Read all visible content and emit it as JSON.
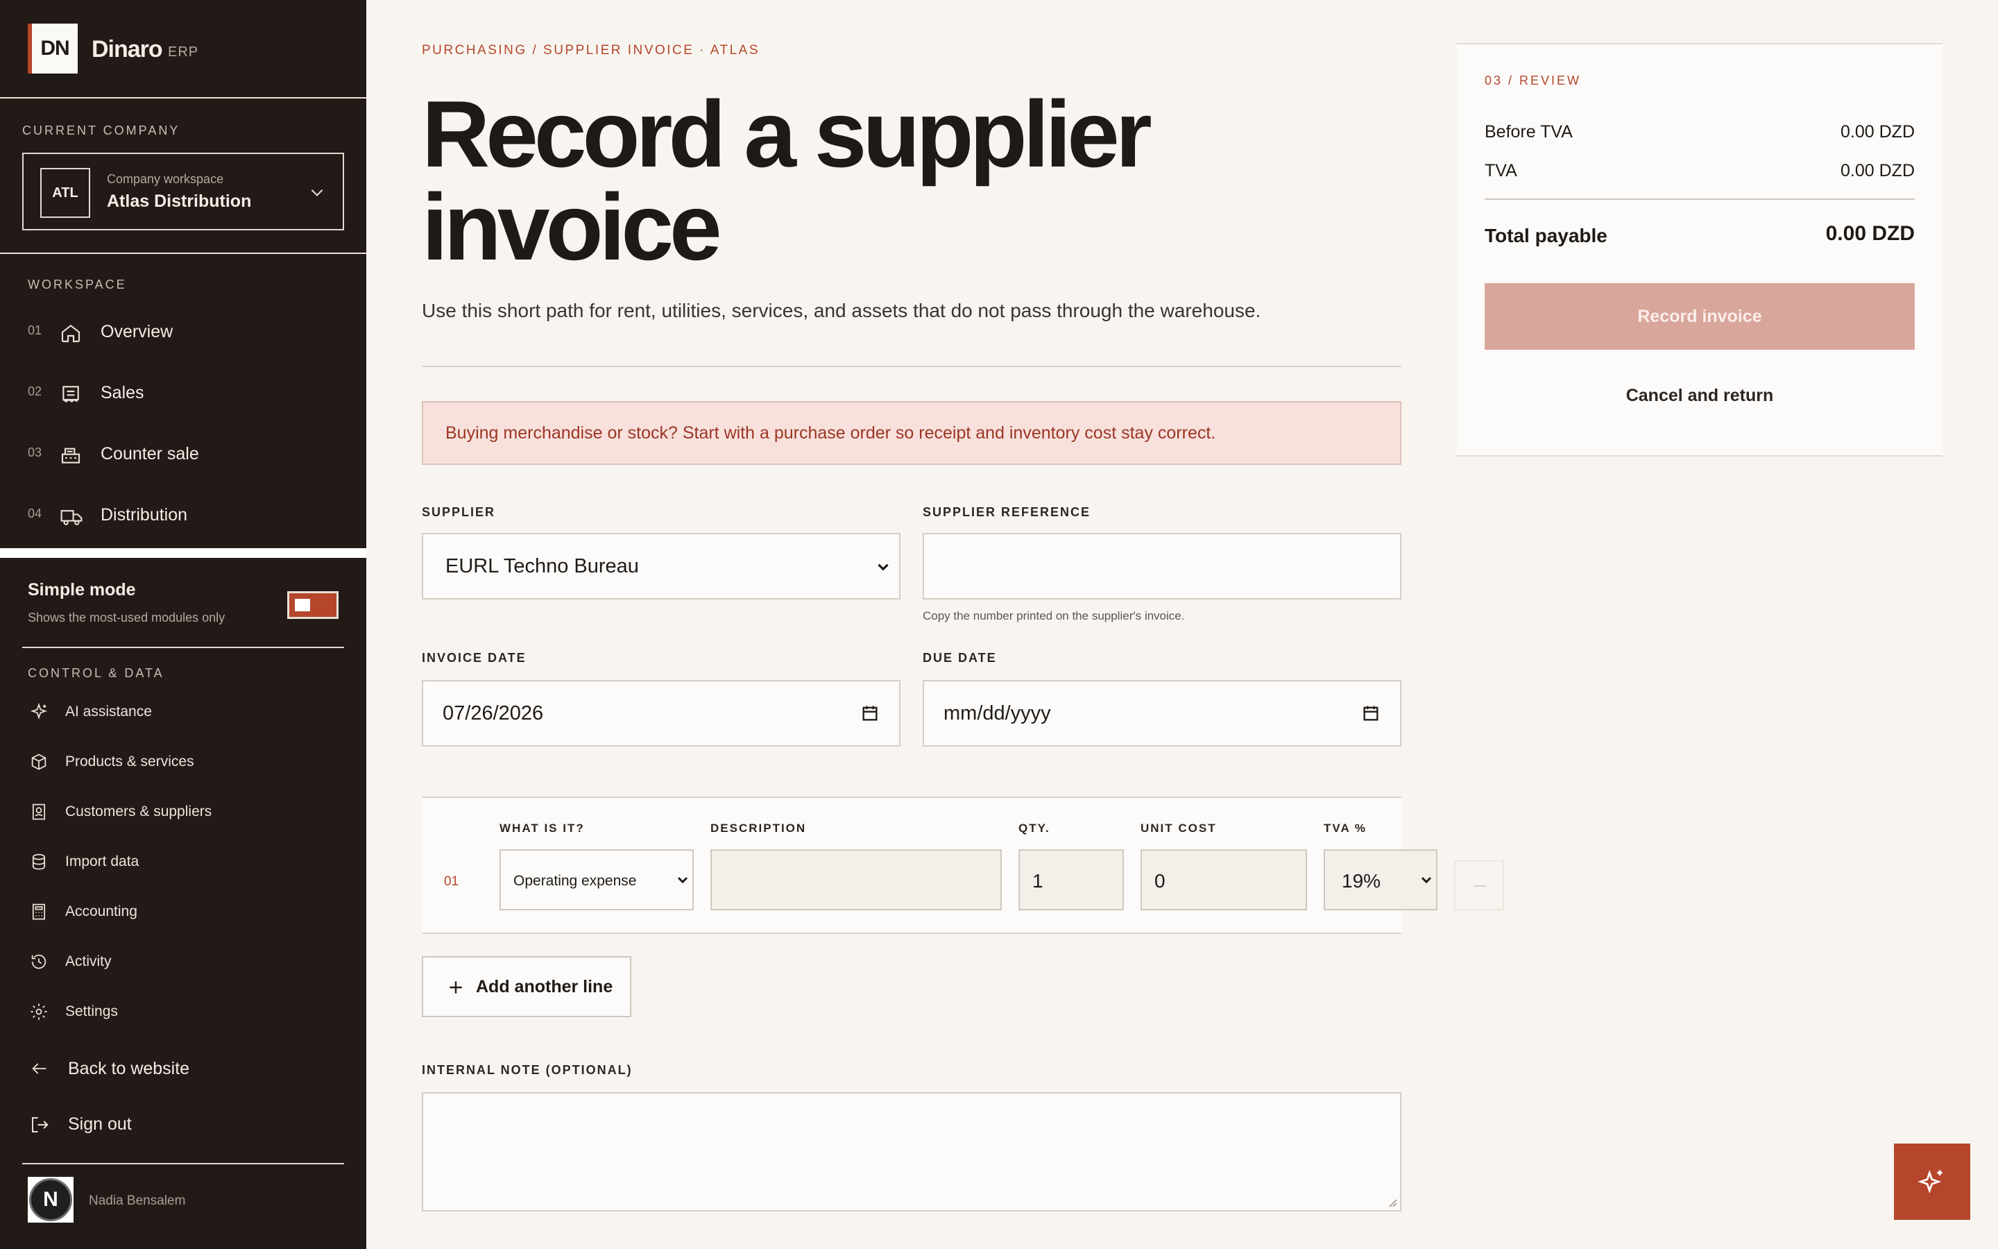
{
  "brand": {
    "logo": "DN",
    "name": "Dinaro",
    "suffix": "ERP"
  },
  "company": {
    "section_label": "CURRENT COMPANY",
    "badge": "ATL",
    "sub": "Company workspace",
    "name": "Atlas Distribution"
  },
  "workspace": {
    "label": "WORKSPACE",
    "items": [
      {
        "num": "01",
        "label": "Overview",
        "icon": "home-icon"
      },
      {
        "num": "02",
        "label": "Sales",
        "icon": "receipt-icon"
      },
      {
        "num": "03",
        "label": "Counter sale",
        "icon": "cash-register-icon"
      },
      {
        "num": "04",
        "label": "Distribution",
        "icon": "truck-icon"
      }
    ]
  },
  "simple_mode": {
    "title": "Simple mode",
    "sub": "Shows the most-used modules only",
    "enabled": true
  },
  "control": {
    "label": "CONTROL & DATA",
    "items": [
      {
        "label": "AI assistance",
        "icon": "sparkles-icon"
      },
      {
        "label": "Products & services",
        "icon": "box-icon"
      },
      {
        "label": "Customers & suppliers",
        "icon": "contact-icon"
      },
      {
        "label": "Import data",
        "icon": "database-icon"
      },
      {
        "label": "Accounting",
        "icon": "calculator-icon"
      },
      {
        "label": "Activity",
        "icon": "history-icon"
      },
      {
        "label": "Settings",
        "icon": "gear-icon"
      }
    ]
  },
  "bottom": {
    "back": "Back to website",
    "signout": "Sign out"
  },
  "user": {
    "initial": "N",
    "name": "Nadia Bensalem"
  },
  "page": {
    "breadcrumb": "PURCHASING / SUPPLIER INVOICE · ATLAS",
    "title_line1": "Record a supplier",
    "title_line2": "invoice",
    "subtitle": "Use this short path for rent, utilities, services, and assets that do not pass through the warehouse.",
    "notice": "Buying merchandise or stock? Start with a purchase order so receipt and inventory cost stay correct."
  },
  "form": {
    "supplier_label": "SUPPLIER",
    "supplier_value": "EURL Techno Bureau",
    "supplier_ref_label": "SUPPLIER REFERENCE",
    "supplier_ref_value": "",
    "supplier_ref_help": "Copy the number printed on the supplier's invoice.",
    "invoice_date_label": "INVOICE DATE",
    "invoice_date_value": "07/26/2026",
    "due_date_label": "DUE DATE",
    "due_date_placeholder": "mm/dd/yyyy",
    "note_label": "INTERNAL NOTE (OPTIONAL)",
    "note_value": ""
  },
  "lines": {
    "columns": {
      "kind": "WHAT IS IT?",
      "description": "DESCRIPTION",
      "qty": "QTY.",
      "unit_cost": "UNIT COST",
      "tva": "TVA %"
    },
    "rows": [
      {
        "num": "01",
        "kind": "Operating expense",
        "description": "",
        "qty": "1",
        "unit_cost": "0",
        "tva": "19%"
      }
    ],
    "add_label": "Add another line"
  },
  "review": {
    "step": "03 / REVIEW",
    "before_tva_label": "Before TVA",
    "before_tva_value": "0.00 DZD",
    "tva_label": "TVA",
    "tva_value": "0.00 DZD",
    "total_label": "Total payable",
    "total_value": "0.00 DZD",
    "record_label": "Record invoice",
    "cancel_label": "Cancel and return"
  },
  "colors": {
    "accent": "#b5462c",
    "sidebar": "#221a17",
    "background": "#f8f5f0",
    "record_disabled": "#d9a69c"
  }
}
